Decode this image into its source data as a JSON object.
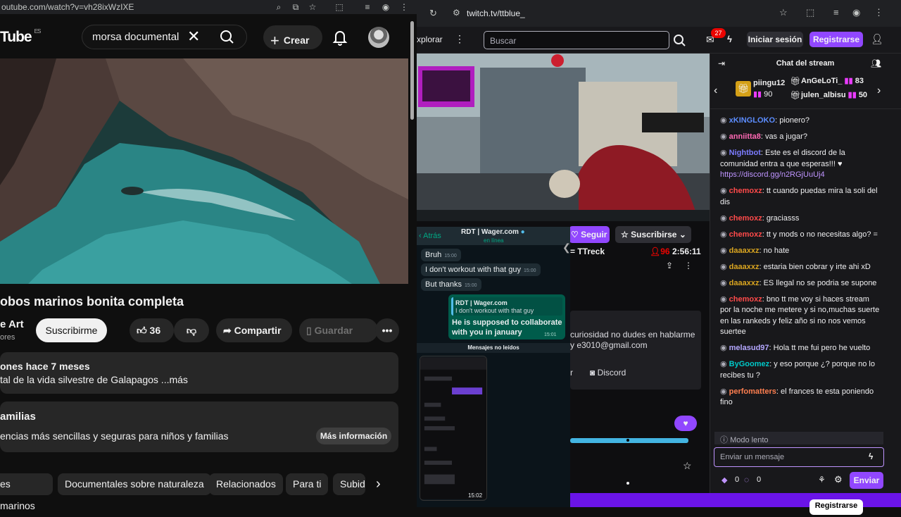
{
  "youtube": {
    "address": "outube.com/watch?v=vh28ixWzIXE",
    "logo": "Tube",
    "logo_region": "ES",
    "search_value": "morsa documental",
    "create_label": "Crear",
    "video_title": "obos marinos bonita completa",
    "channel_name": "e Art",
    "channel_subs": "ores",
    "subscribe_label": "Suscribirme",
    "likes": "36",
    "share_label": "Compartir",
    "save_label": "Guardar",
    "description_meta": "ones  hace 7 meses",
    "description_text": "tal de la vida silvestre de Galapagos ...más",
    "families_title": "amilias",
    "families_text": "encias más sencillas y seguras para niños y familias",
    "more_info_label": "Más información",
    "chips": [
      "es marinos",
      "Documentales sobre naturaleza",
      "Relacionados",
      "Para ti",
      "Subid"
    ]
  },
  "twitch": {
    "url": "twitch.tv/ttblue_",
    "explore_label": "xplorar",
    "search_placeholder": "Buscar",
    "notification_count": "27",
    "login_label": "Iniciar sesión",
    "register_label": "Registrarse",
    "follow_label": "Seguir",
    "subscribe_label": "Suscribirse",
    "streamer_line": "= TTreck",
    "viewers": "96",
    "uptime": "2:56:11",
    "about_text": "curiosidad no dudes en hablarme y e3010@gmail.com",
    "menu_letter": "r",
    "discord_label": "Discord",
    "register_bottom": "Registrarse",
    "chat": {
      "title": "Chat del stream",
      "gifters": [
        {
          "name": "piingu12",
          "count": "90"
        },
        {
          "name": "AnGeLoTi_",
          "count": "83"
        },
        {
          "name": "julen_albisu",
          "count": "50"
        }
      ],
      "messages": [
        {
          "user": "xKINGLOKO",
          "color": "#5c8dff",
          "text": "pionero?"
        },
        {
          "user": "anniitta8",
          "color": "#ff69b4",
          "text": "vas a jugar?"
        },
        {
          "user": "Nightbot",
          "color": "#7c7cff",
          "text": "Este es el discord de la comunidad entra a que esperas!!! ♥",
          "link": "https://discord.gg/n2RGjUuUj4"
        },
        {
          "user": "chemoxz",
          "color": "#ff4a4a",
          "text": "tt cuando puedas mira la soli del dis"
        },
        {
          "user": "chemoxz",
          "color": "#ff4a4a",
          "text": "graciasss"
        },
        {
          "user": "chemoxz",
          "color": "#ff4a4a",
          "text": "tt y mods o no necesitas algo? ="
        },
        {
          "user": "daaaxxz",
          "color": "#daa520",
          "text": "no hate"
        },
        {
          "user": "daaaxxz",
          "color": "#daa520",
          "text": "estaria bien cobrar y irte ahi xD"
        },
        {
          "user": "daaaxxz",
          "color": "#daa520",
          "text": "ES llegal no se podria se supone"
        },
        {
          "user": "chemoxz",
          "color": "#ff4a4a",
          "text": "bno tt me voy si haces stream por la noche me metere y si no,muchas suerte en las rankeds y feliz año si no nos vemos suertee"
        },
        {
          "user": "melasud97",
          "color": "#b4a7ff",
          "text": "Hola tt me fui pero he vuelto"
        },
        {
          "user": "ByGoomez",
          "color": "#00c8c8",
          "text": "y eso porque ¿? porque no lo recibes tu ?"
        },
        {
          "user": "perfomatters",
          "color": "#ff7f50",
          "text": "el frances te esta poniendo fino"
        }
      ],
      "slow_mode": "Modo lento",
      "input_placeholder": "Enviar un mensaje",
      "points_a": "0",
      "points_b": "0",
      "send_label": "Enviar"
    }
  },
  "whatsapp": {
    "back_label": "Atrás",
    "contact": "RDT | Wager.com",
    "status": "en línea",
    "messages": [
      {
        "text": "Bruh",
        "time": "15:00"
      },
      {
        "text": "I don't workout with that guy",
        "time": "15:00"
      },
      {
        "text": "But thanks",
        "time": "15:00"
      }
    ],
    "quote_name": "RDT | Wager.com",
    "quote_text": "I don't workout with that guy",
    "out_text": "He is supposed to collaborate with you in january",
    "out_time": "15:01",
    "unread_label": "Mensajes no leídos",
    "screenshot_time": "15:02"
  }
}
